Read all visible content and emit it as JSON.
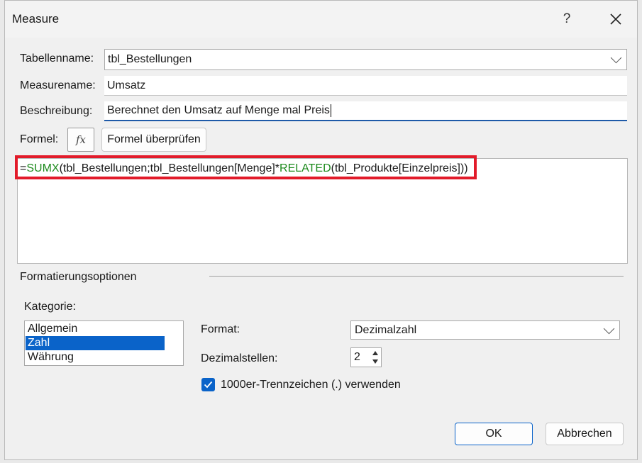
{
  "window": {
    "title": "Measure",
    "help_label": "?"
  },
  "form": {
    "table_label": "Tabellenname:",
    "table_value": "tbl_Bestellungen",
    "measure_label": "Measurename:",
    "measure_value": "Umsatz",
    "description_label": "Beschreibung:",
    "description_value": "Berechnet den Umsatz auf Menge mal Preis",
    "formula_label": "Formel:",
    "fx_label": "fx",
    "check_formula_label": "Formel überprüfen"
  },
  "formula": {
    "eq": "=",
    "fn1": "SUMX",
    "part1": "(tbl_Bestellungen;tbl_Bestellungen[Menge]*",
    "fn2": "RELATED",
    "part2": "(tbl_Produkte[Einzelpreis]))"
  },
  "formatting": {
    "group_label": "Formatierungsoptionen",
    "category_label": "Kategorie:",
    "categories": [
      "Allgemein",
      "Zahl",
      "Währung"
    ],
    "selected_category": "Zahl",
    "format_label": "Format:",
    "format_value": "Dezimalzahl",
    "decimals_label": "Dezimalstellen:",
    "decimals_value": "2",
    "thousands_label": "1000er-Trennzeichen (.) verwenden",
    "thousands_checked": true
  },
  "buttons": {
    "ok": "OK",
    "cancel": "Abbrechen"
  },
  "colors": {
    "accent": "#0a63c9",
    "function_green": "#1c8a1c",
    "highlight_red": "#e21b2a"
  }
}
